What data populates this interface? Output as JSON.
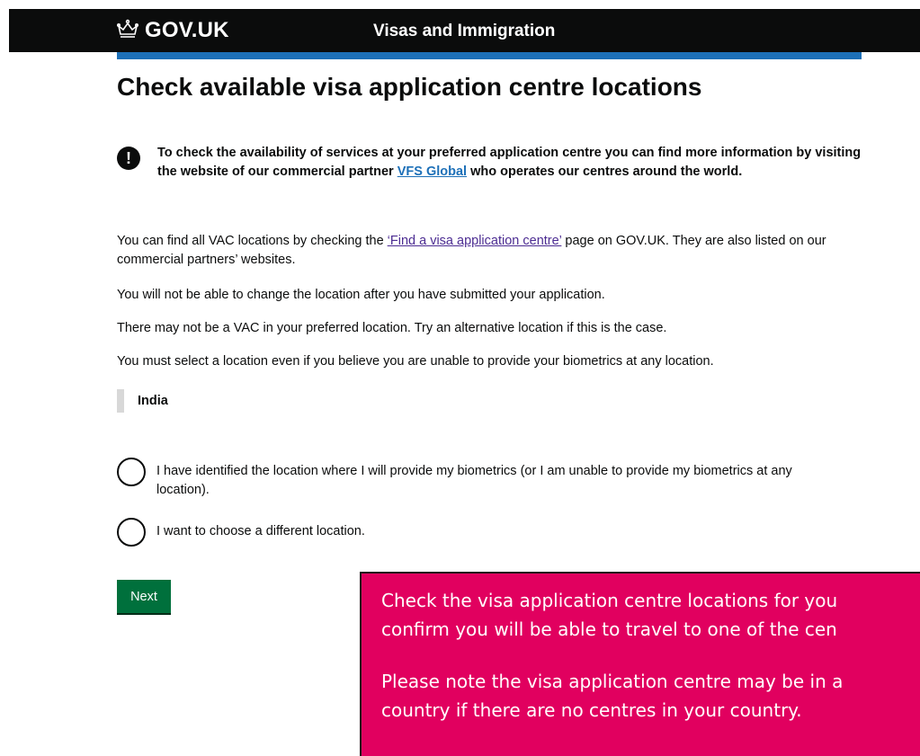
{
  "header": {
    "logo_text": "GOV.UK",
    "service_name": "Visas and Immigration",
    "background_color": "#0b0c0c",
    "accent_color": "#1d70b8"
  },
  "page_title": "Check available visa application centre locations",
  "warning": {
    "icon": "exclamation-icon",
    "text_before": "To check the availability of services at your preferred application centre you can find more information by visiting the website of our commercial partner ",
    "link_text": "VFS Global",
    "text_after": " who operates our centres around the world."
  },
  "paragraphs": {
    "p1_before": "You can find all VAC locations by checking the ",
    "p1_link": "‘Find a visa application centre’",
    "p1_after": " page on GOV.UK. They are also listed on our commercial partners’ websites.",
    "p2": "You will not be able to change the location after you have submitted your application.",
    "p3": "There may not be a VAC in your preferred location. Try an alternative location if this is the case.",
    "p4": "You must select a location even if you believe you are unable to provide your biometrics at any location."
  },
  "selected_country": "India",
  "options": [
    {
      "label": "I have identified the location where I will provide my biometrics (or I am unable to provide my biometrics at any location).",
      "selected": false
    },
    {
      "label": "I want to choose a different location.",
      "selected": false
    }
  ],
  "next_button": "Next",
  "callout": {
    "line1": "Check the visa application centre locations for you",
    "line2": "confirm you will be able to travel to one of the cen",
    "line3": "Please note the visa application centre may be in a",
    "line4": "country if there are no centres in your country.",
    "background_color": "#e1005f"
  }
}
